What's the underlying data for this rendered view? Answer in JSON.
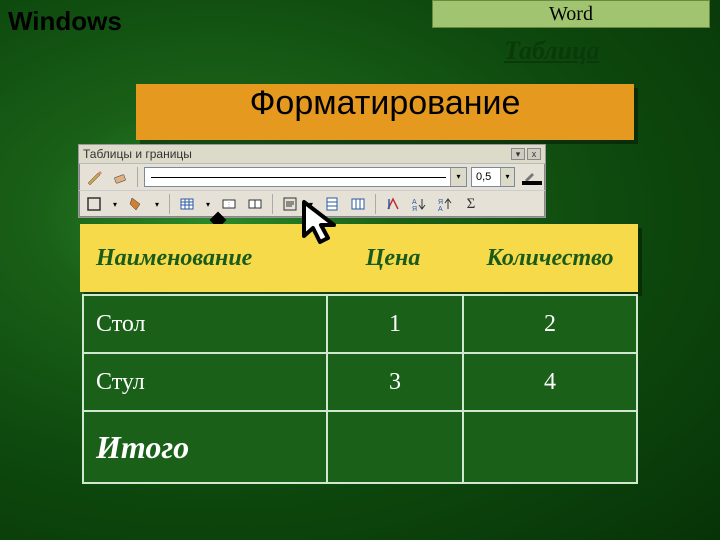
{
  "header": {
    "left_title": "Windows",
    "right_tab": "Word",
    "subtitle": "Таблица"
  },
  "banner": "Форматирование",
  "toolbar": {
    "title": "Таблицы и границы",
    "line_weight": "0,5",
    "icons_row1": [
      "draw-table",
      "eraser",
      "line-style",
      "line-weight",
      "border-color"
    ],
    "icons_row2": [
      "border-outside",
      "border-dropdown",
      "shading",
      "insert-table",
      "table-grid",
      "merge-cells",
      "split-cells",
      "align",
      "distribute-rows",
      "distribute-cols",
      "autofit",
      "sort-asc",
      "sort-desc",
      "autosum"
    ]
  },
  "columns": {
    "name": "Наименование",
    "price": "Цена",
    "qty": "Количество"
  },
  "rows": [
    {
      "name": "Стол",
      "price": "1",
      "qty": "2"
    },
    {
      "name": "Стул",
      "price": "3",
      "qty": "4"
    }
  ],
  "total_label": "Итого"
}
